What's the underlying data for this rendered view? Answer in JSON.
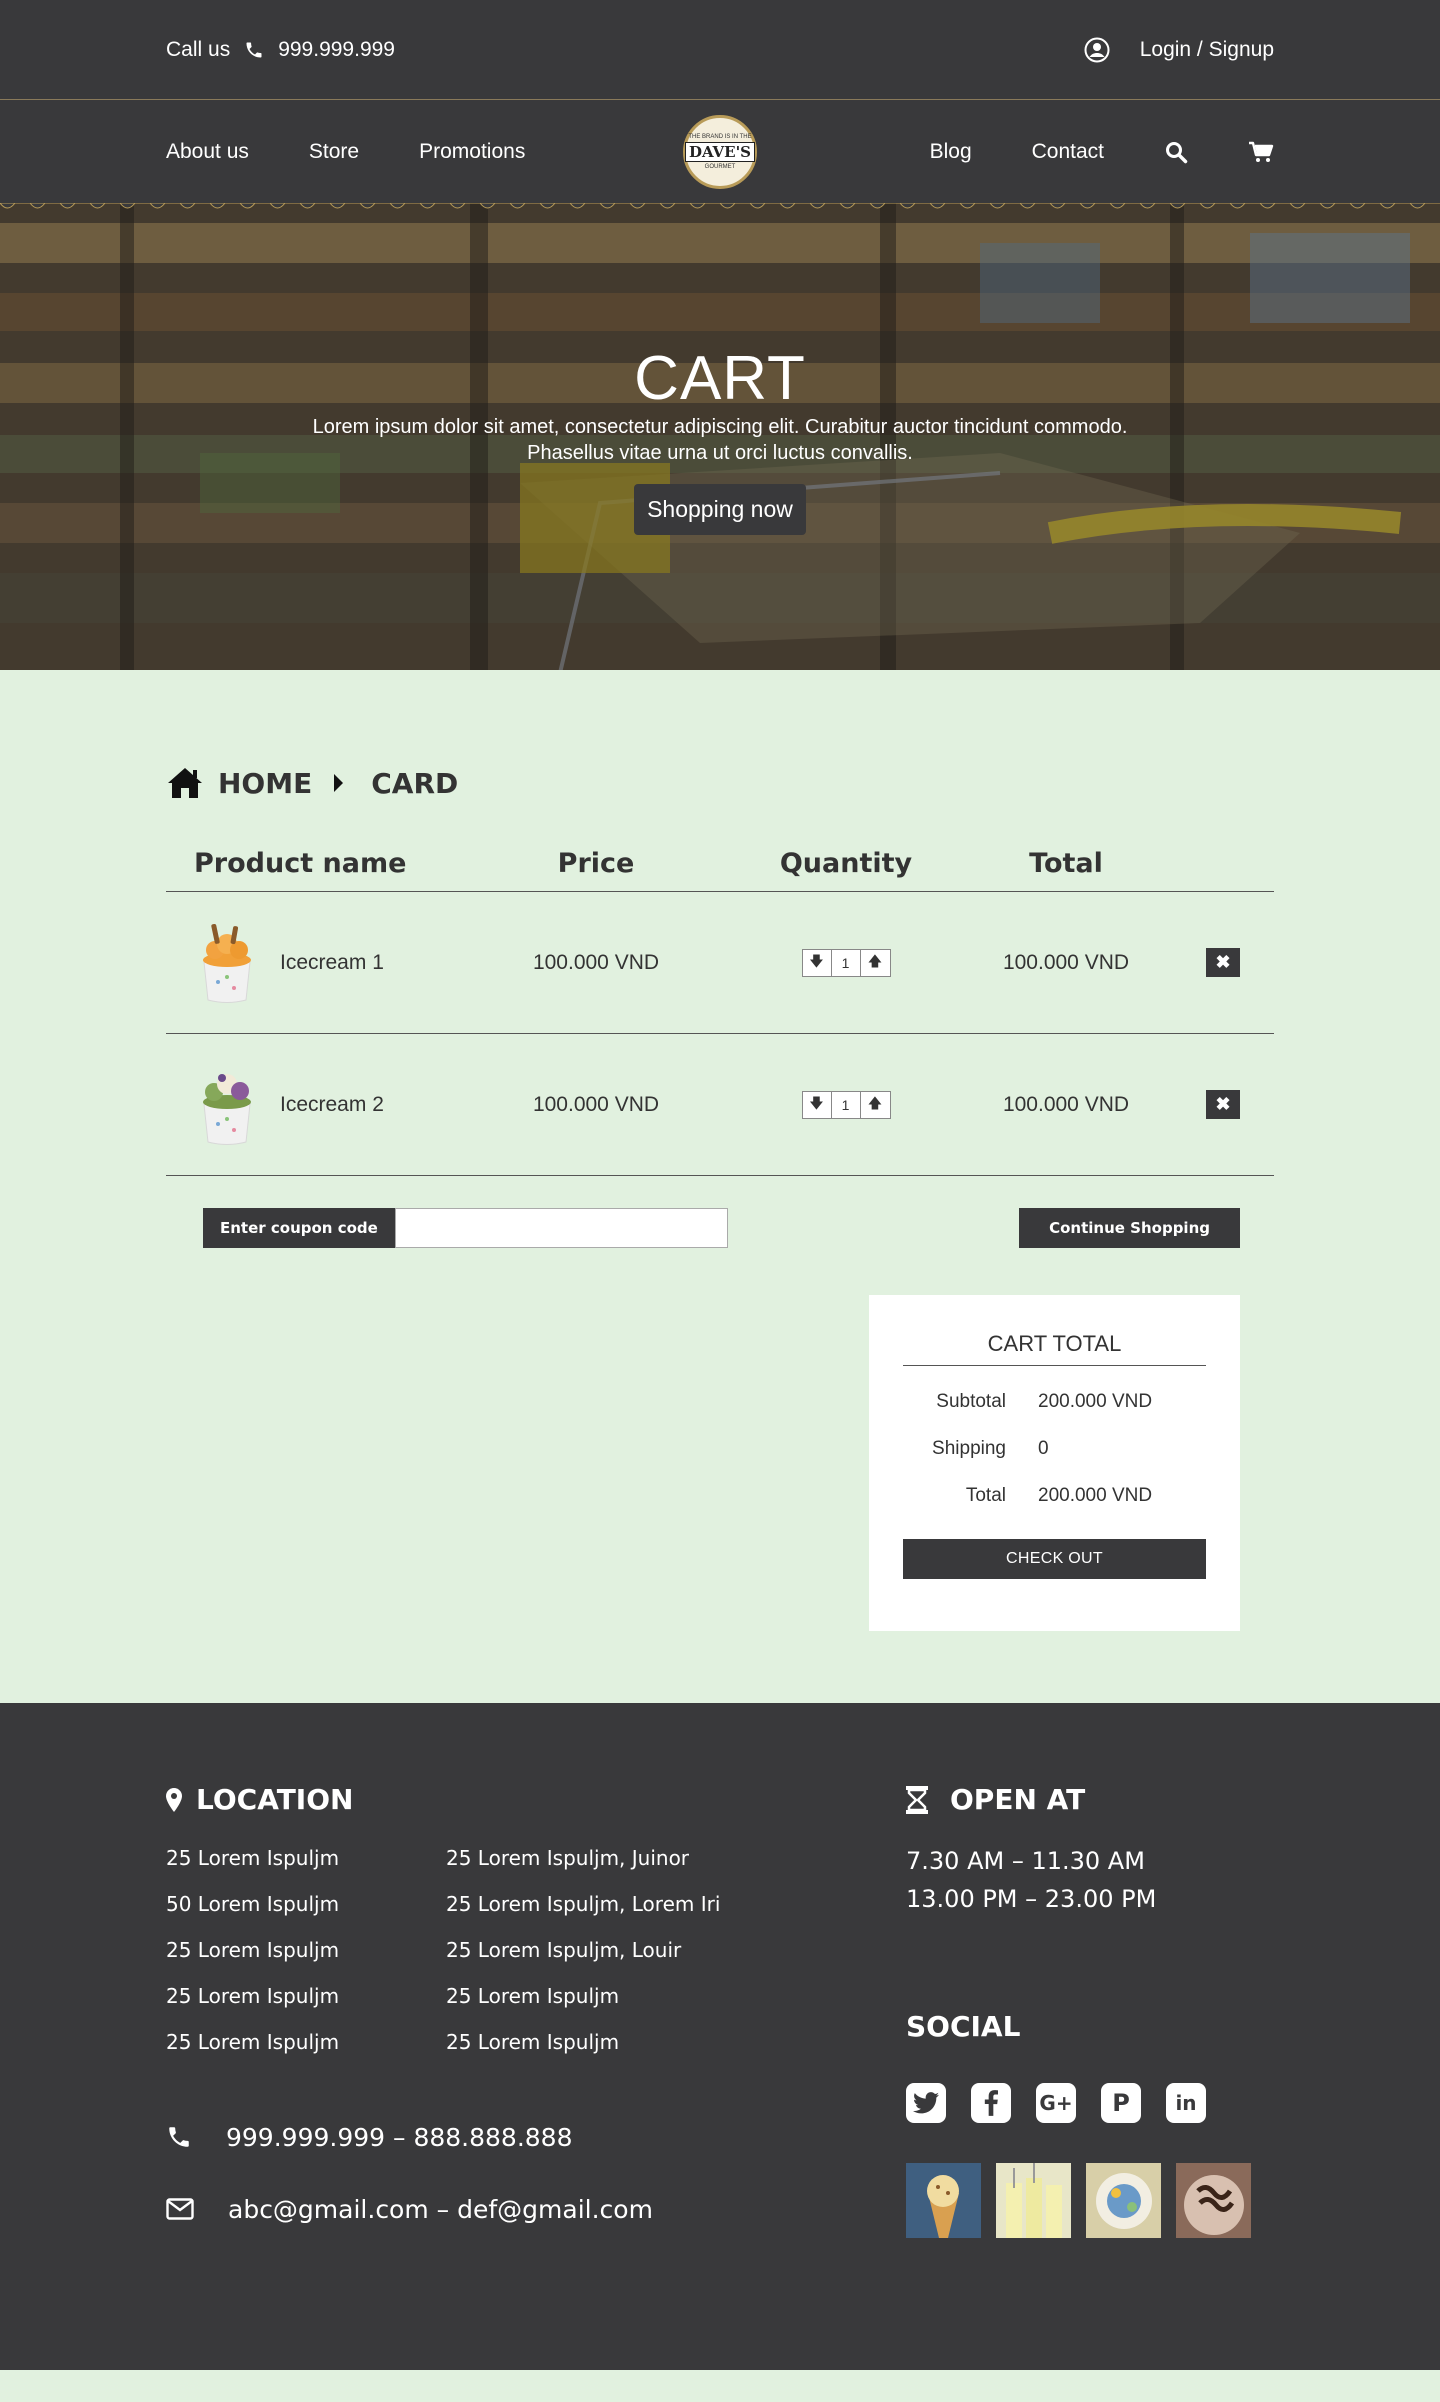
{
  "topbar": {
    "call_label": "Call us",
    "phone": "999.999.999",
    "login_label": "Login / Signup"
  },
  "nav": {
    "left": [
      "About us",
      "Store",
      "Promotions"
    ],
    "right": [
      "Blog",
      "Contact"
    ],
    "logo_text": "DAVE'S",
    "logo_top": "THE BRAND IS IN THE",
    "logo_bottom": "GOURMET"
  },
  "hero": {
    "title": "CART",
    "desc_line1": "Lorem ipsum dolor sit amet, consectetur adipiscing elit. Curabitur auctor tincidunt commodo.",
    "desc_line2": "Phasellus vitae urna ut orci luctus convallis.",
    "button": "Shopping now"
  },
  "breadcrumb": {
    "home": "HOME",
    "current": "CARD"
  },
  "table": {
    "headers": [
      "Product name",
      "Price",
      "Quantity",
      "Total"
    ],
    "rows": [
      {
        "name": "Icecream 1",
        "price": "100.000 VND",
        "qty": "1",
        "total": "100.000 VND"
      },
      {
        "name": "Icecream 2",
        "price": "100.000 VND",
        "qty": "1",
        "total": "100.000 VND"
      }
    ]
  },
  "coupon": {
    "label": "Enter coupon code",
    "value": "",
    "continue": "Continue Shopping"
  },
  "cart_total": {
    "title": "CART TOTAL",
    "subtotal_label": "Subtotal",
    "subtotal": "200.000 VND",
    "shipping_label": "Shipping",
    "shipping": "0",
    "total_label": "Total",
    "total": "200.000 VND",
    "checkout": "CHECK OUT"
  },
  "footer": {
    "location_title": "LOCATION",
    "locations_col1": [
      "25 Lorem Ispuljm",
      "50 Lorem Ispuljm",
      "25 Lorem Ispuljm",
      "25 Lorem Ispuljm",
      "25 Lorem Ispuljm"
    ],
    "locations_col2": [
      "25 Lorem Ispuljm, Juinor",
      "25 Lorem Ispuljm, Lorem Iri",
      "25 Lorem Ispuljm, Louir",
      "25 Lorem Ispuljm",
      "25 Lorem Ispuljm"
    ],
    "phones": "999.999.999 – 888.888.888",
    "emails": "abc@gmail.com – def@gmail.com",
    "open_title": "OPEN AT",
    "hours_1": "7.30 AM  – 11.30 AM",
    "hours_2": "13.00 PM  – 23.00 PM",
    "social_title": "SOCIAL",
    "social_icons": [
      "twitter-icon",
      "facebook-icon",
      "google-plus-icon",
      "pinterest-icon",
      "linkedin-icon"
    ]
  },
  "colors": {
    "dark": "#39393b",
    "page_bg": "#e1f1df",
    "white": "#ffffff"
  }
}
